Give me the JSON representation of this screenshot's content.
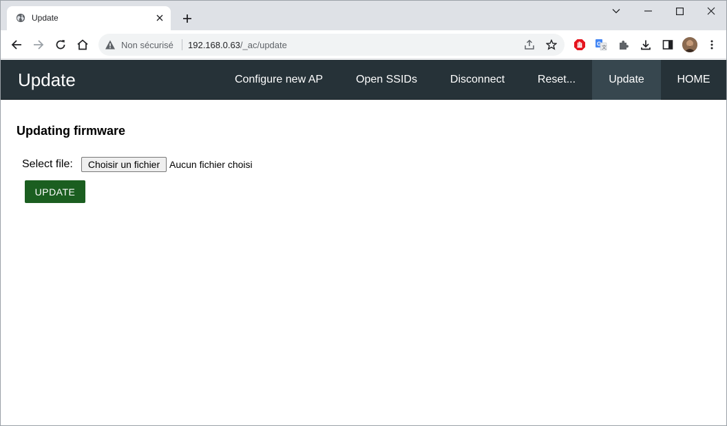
{
  "browser": {
    "tab_title": "Update",
    "security_label": "Non sécurisé",
    "url_host": "192.168.0.63",
    "url_path": "/_ac/update"
  },
  "nav": {
    "brand": "Update",
    "items": [
      {
        "label": "Configure new AP",
        "active": false
      },
      {
        "label": "Open SSIDs",
        "active": false
      },
      {
        "label": "Disconnect",
        "active": false
      },
      {
        "label": "Reset...",
        "active": false
      },
      {
        "label": "Update",
        "active": true
      },
      {
        "label": "HOME",
        "active": false
      }
    ]
  },
  "form": {
    "heading": "Updating firmware",
    "select_label": "Select file:",
    "file_button_label": "Choisir un fichier",
    "file_status": "Aucun fichier choisi",
    "submit_label": "UPDATE"
  },
  "colors": {
    "nav_bg": "#263238",
    "nav_active_bg": "#37474f",
    "submit_bg": "#1b5e20"
  },
  "icons": {
    "tab_favicon": "globe-icon",
    "security": "warning-triangle-icon",
    "extensions": [
      "adblock-icon",
      "google-translate-icon",
      "puzzle-icon",
      "download-icon",
      "side-panel-icon"
    ]
  }
}
